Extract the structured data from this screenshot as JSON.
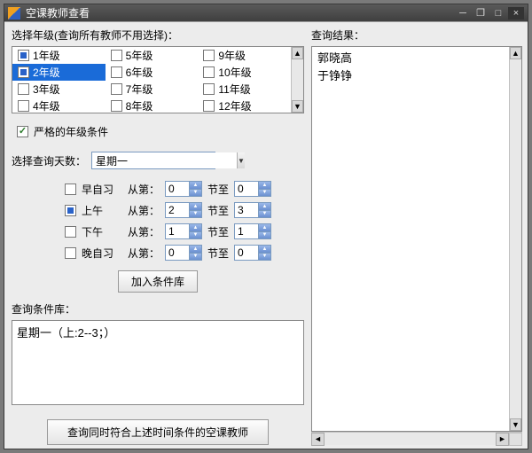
{
  "window": {
    "title": "空课教师查看"
  },
  "titlebar_buttons": {
    "min": "─",
    "restore": "❐",
    "max": "□",
    "close": "×"
  },
  "left": {
    "grade_label": "选择年级(查询所有教师不用选择)：",
    "grades": [
      {
        "label": "1年级",
        "state": "filled"
      },
      {
        "label": "5年级",
        "state": ""
      },
      {
        "label": "9年级",
        "state": ""
      },
      {
        "label": "2年级",
        "state": "filled",
        "selected": true
      },
      {
        "label": "6年级",
        "state": ""
      },
      {
        "label": "10年级",
        "state": ""
      },
      {
        "label": "3年级",
        "state": ""
      },
      {
        "label": "7年级",
        "state": ""
      },
      {
        "label": "11年级",
        "state": ""
      },
      {
        "label": "4年级",
        "state": ""
      },
      {
        "label": "8年级",
        "state": ""
      },
      {
        "label": "12年级",
        "state": ""
      }
    ],
    "strict_label": "严格的年级条件",
    "day_label": "选择查询天数：",
    "day_value": "星期一",
    "from_label": "从第：",
    "to_label": "节至",
    "periods": [
      {
        "name": "早自习",
        "checked": false,
        "from": "0",
        "to": "0"
      },
      {
        "name": "上午",
        "checked": true,
        "from": "2",
        "to": "3"
      },
      {
        "name": "下午",
        "checked": false,
        "from": "1",
        "to": "1"
      },
      {
        "name": "晚自习",
        "checked": false,
        "from": "0",
        "to": "0"
      }
    ],
    "add_button": "加入条件库",
    "cond_label": "查询条件库：",
    "cond_text": "星期一（上:2--3；）",
    "query_button": "查询同时符合上述时间条件的空课教师"
  },
  "right": {
    "results_label": "查询结果：",
    "results": [
      "郭晓高",
      "于铮铮"
    ]
  }
}
